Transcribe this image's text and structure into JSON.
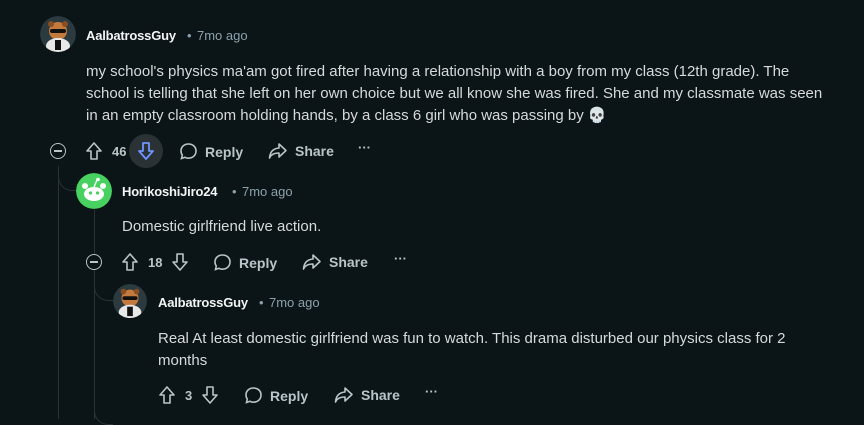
{
  "comments": [
    {
      "username": "AalbatrossGuy",
      "separator": "•",
      "time": "7mo ago",
      "body_lines": [
        "my school's physics ma'am got fired after having a relationship with a boy from my class (12th grade). The",
        "school is telling that she left on her own choice but we all know she was fired. She and my classmate was seen",
        "in an empty classroom holding hands, by a class 6 girl who was passing by 💀"
      ],
      "votes": "46",
      "reply_label": "Reply",
      "share_label": "Share",
      "more_label": "···"
    },
    {
      "username": "HorikoshiJiro24",
      "separator": "•",
      "time": "7mo ago",
      "body_lines": [
        "Domestic girlfriend live action."
      ],
      "votes": "18",
      "reply_label": "Reply",
      "share_label": "Share",
      "more_label": "···"
    },
    {
      "username": "AalbatrossGuy",
      "separator": "•",
      "time": "7mo ago",
      "body_lines": [
        "Real At least domestic girlfriend was fun to watch. This drama disturbed our physics class for 2",
        "months"
      ],
      "votes": "3",
      "reply_label": "Reply",
      "share_label": "Share",
      "more_label": "···"
    }
  ],
  "colors": {
    "background": "#0b1416",
    "text": "#d7dadc",
    "meta": "#8ba2ad",
    "snoo_avatar_bg": "#46d160",
    "downvote_active": "#7193ff"
  }
}
